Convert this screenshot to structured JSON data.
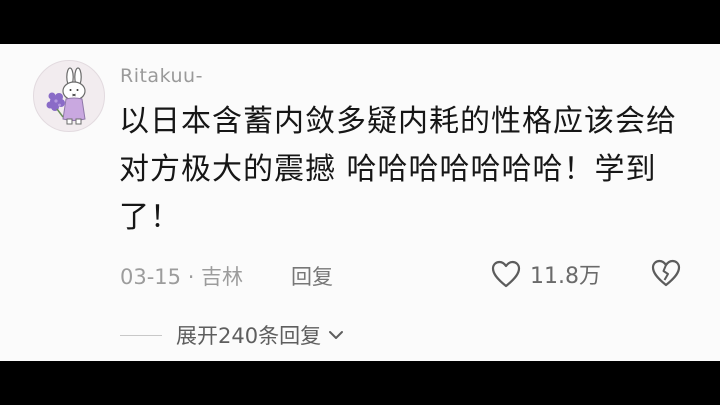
{
  "comment": {
    "username": "Ritakuu-",
    "text_lines": [
      "以日本含蓄内敛多疑内耗的性格应该会给",
      "对方极大的震撼 哈哈哈哈哈哈哈！学到",
      "了！"
    ],
    "date_location": "03-15 · 吉林",
    "reply_label": "回复",
    "like_count": "11.8万",
    "expand_replies_label": "展开240条回复"
  },
  "icons": {
    "like": "heart-outline-icon",
    "dislike": "broken-heart-icon",
    "expand": "chevron-down-icon"
  },
  "colors": {
    "background": "#fbfbfb",
    "text": "#161616",
    "muted": "#9c9c9c",
    "avatar_flower": "#8a6bc7"
  }
}
